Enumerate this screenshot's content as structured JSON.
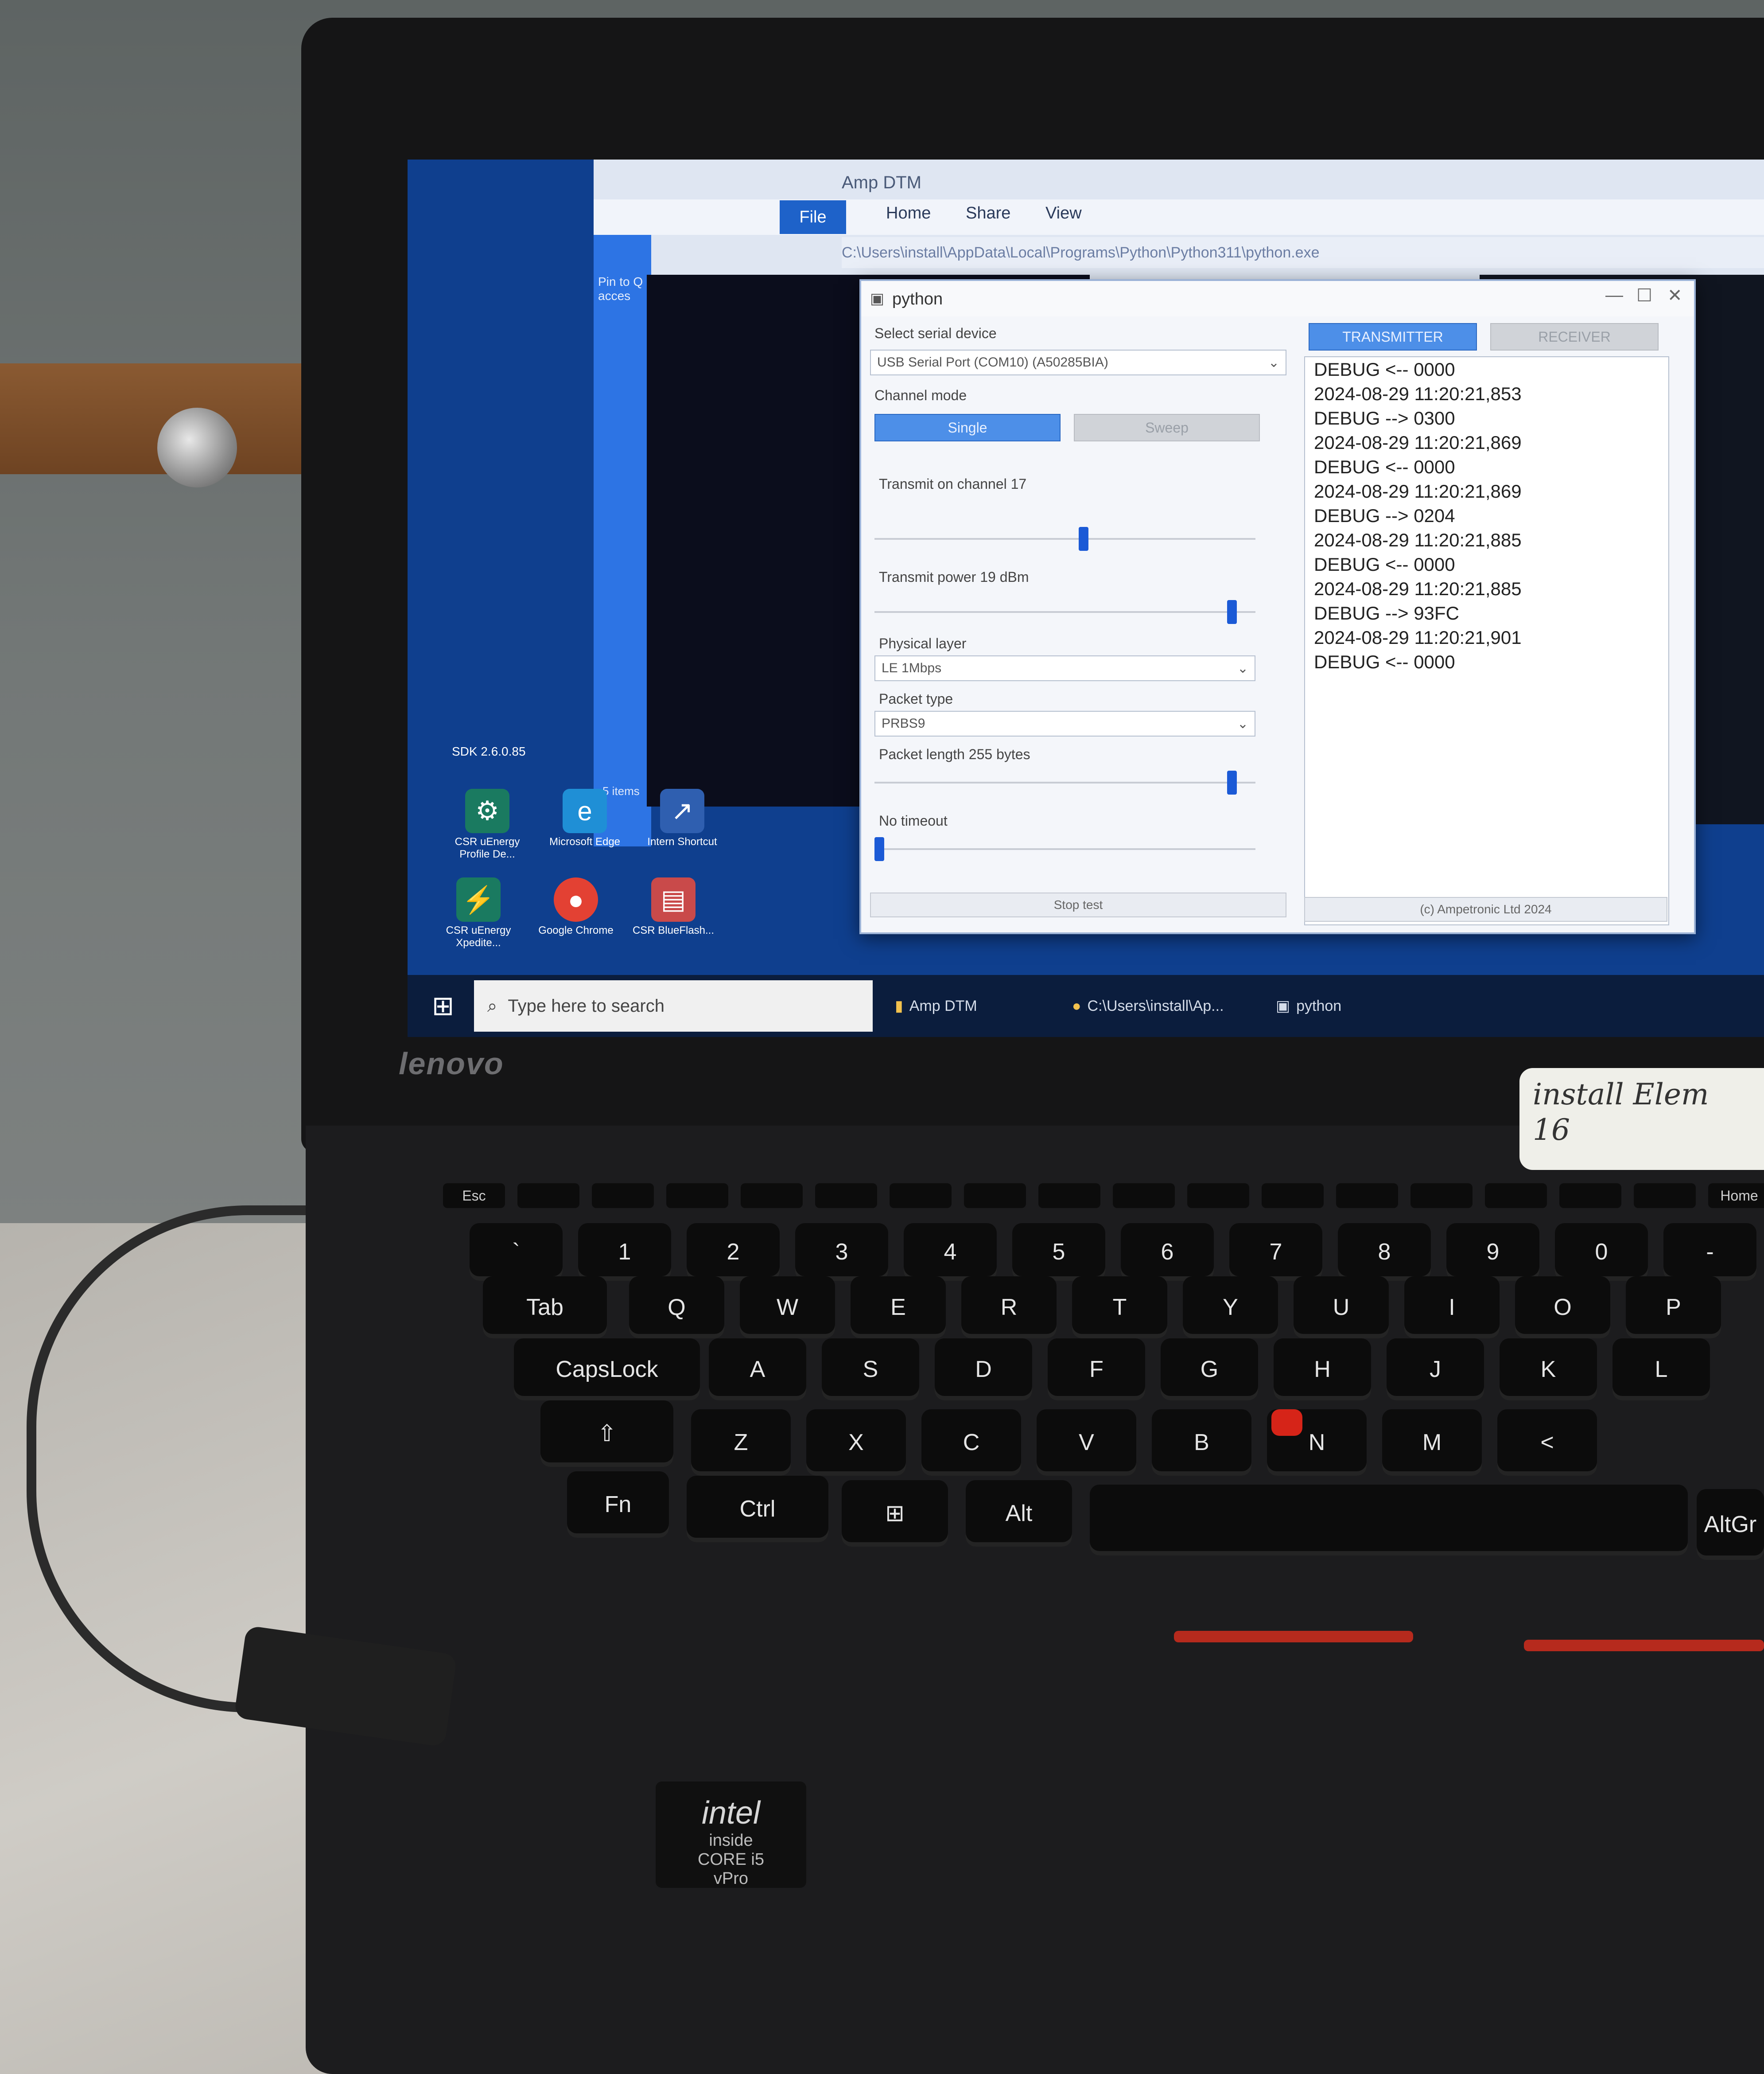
{
  "explorer": {
    "title": "Amp DTM",
    "tabs": [
      "File",
      "Home",
      "Share",
      "View"
    ],
    "address": "C:\\Users\\install\\AppData\\Local\\Programs\\Python\\Python311\\python.exe",
    "nav_item": "Pin to Q",
    "nav_item2": "acces",
    "status": "5 items"
  },
  "python_window": {
    "title": "python",
    "select_label": "Select serial device",
    "device_value": "USB Serial Port (COM10) (A50285BIA)",
    "channel_mode_label": "Channel mode",
    "mode_single": "Single",
    "mode_sweep": "Sweep",
    "channel_label": "Transmit on channel 17",
    "power_label": "Transmit power 19 dBm",
    "phy_label": "Physical layer",
    "phy_value": "LE 1Mbps",
    "packet_type_label": "Packet type",
    "packet_type_value": "PRBS9",
    "packet_length_label": "Packet length 255 bytes",
    "timeout_label": "No timeout",
    "stop_button": "Stop test",
    "tab_transmitter": "TRANSMITTER",
    "tab_receiver": "RECEIVER",
    "copyright": "(c) Ampetronic Ltd 2024",
    "log_lines": [
      "DEBUG <-- 0000",
      "2024-08-29 11:20:21,853",
      "DEBUG --> 0300",
      "2024-08-29 11:20:21,869",
      "DEBUG <-- 0000",
      "2024-08-29 11:20:21,869",
      "DEBUG --> 0204",
      "2024-08-29 11:20:21,885",
      "DEBUG <-- 0000",
      "2024-08-29 11:20:21,885",
      "DEBUG --> 93FC",
      "2024-08-29 11:20:21,901",
      "DEBUG <-- 0000"
    ],
    "channel_level": 0.55,
    "power_level": 0.95,
    "length_level": 0.95,
    "timeout_level": 0.0
  },
  "desktop_icons": [
    {
      "label": "CSR uEnergy Profile De...",
      "icon": "csr-icon"
    },
    {
      "label": "Microsoft Edge",
      "icon": "edge-icon"
    },
    {
      "label": "Intern Shortcut",
      "icon": "shortcut-icon"
    },
    {
      "label": "CSR uEnergy Xpedite...",
      "icon": "xpedite-icon"
    },
    {
      "label": "Google Chrome",
      "icon": "chrome-icon"
    },
    {
      "label": "CSR BlueFlash...",
      "icon": "blueflash-icon"
    }
  ],
  "desktop_side_label": "SDK 2.6.0.85",
  "taskbar": {
    "search_placeholder": "Type here to search",
    "tasks": [
      "Amp DTM",
      "C:\\Users\\install\\Ap...",
      "python"
    ]
  },
  "hardware": {
    "brand": "lenovo",
    "sticker_line1": "install Elem",
    "sticker_line2": "16",
    "intel_logo": "intel",
    "intel_line1": "inside",
    "intel_line2": "CORE i5",
    "intel_line3": "vPro"
  },
  "keyboard": {
    "row_num": [
      "`",
      "1",
      "2",
      "3",
      "4",
      "5",
      "6",
      "7",
      "8",
      "9",
      "0",
      "-"
    ],
    "row_q": [
      "Q",
      "W",
      "E",
      "R",
      "T",
      "Y",
      "U",
      "I",
      "O",
      "P"
    ],
    "row_a": [
      "A",
      "S",
      "D",
      "F",
      "G",
      "H",
      "J",
      "K",
      "L"
    ],
    "row_z": [
      "Z",
      "X",
      "C",
      "V",
      "B",
      "N",
      "M",
      "<"
    ],
    "tab": "Tab",
    "caps": "CapsLock",
    "shift": "⇧",
    "fn": "Fn",
    "ctrl": "Ctrl",
    "alt": "Alt",
    "altgr": "AltGr",
    "esc": "Esc",
    "home": "Home"
  }
}
